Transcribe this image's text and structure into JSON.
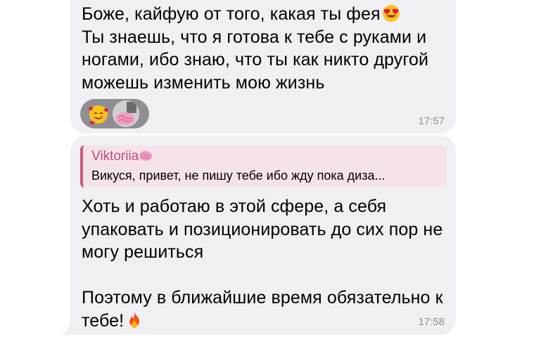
{
  "messages": [
    {
      "text_line1": "Боже, кайфую от того, какая ты фея",
      "text_rest": "Ты знаешь, что я готова к тебе с руками и\nногами, ибо знаю, что ты как никто другой\nможешь изменить мою жизнь",
      "inline_emoji": "heart-eyes-emoji",
      "reaction_emoji": "smiling-face-with-hearts",
      "time": "17:57"
    },
    {
      "reply_name": "Viktoriia",
      "reply_name_emoji": "brain-emoji",
      "reply_text": "Викуся, привет, не пишу тебе ибо жду пока диза...",
      "text": "Хоть и работаю в этой сфере, а себя\nупаковать и позиционировать до сих пор не\nмогу решиться\n\nПоэтому в ближайшие время обязательно к\nтебе!",
      "inline_emoji": "fire-emoji",
      "time": "17:58"
    }
  ],
  "colors": {
    "bubble": "#efeff4",
    "reply_accent": "#d0577f",
    "reply_bg": "#f6e3ea",
    "timestamp": "#8e8e93",
    "reaction_pill": "#8e8e93"
  }
}
